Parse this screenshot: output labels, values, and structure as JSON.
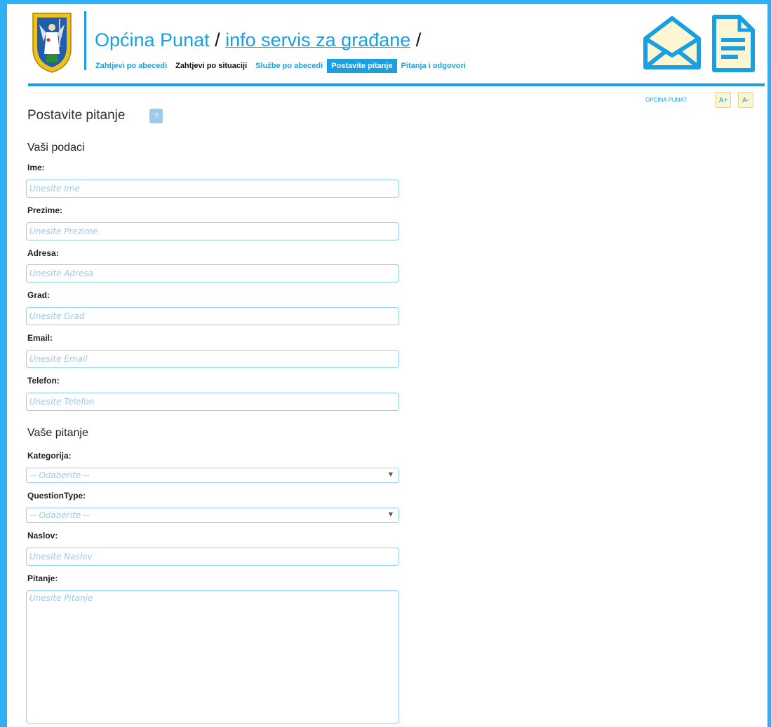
{
  "header": {
    "municipality": "Općina Punat",
    "separator1": " / ",
    "service": "info servis za građane",
    "separator2": " /",
    "nav": [
      {
        "label": "Zahtjevi po abecedi"
      },
      {
        "label": "Zahtjevi po situaciji"
      },
      {
        "label": "Službe po abecedi"
      },
      {
        "label": "Postavite pitanje",
        "active": true
      },
      {
        "label": "Pitanja i odgovori"
      }
    ],
    "icons": [
      "mail-icon",
      "document-icon"
    ]
  },
  "breadcrumb": "OPĆINA PUNAT",
  "font_controls": {
    "increase": "A+",
    "decrease": "A-"
  },
  "page_title": "Postavite pitanje",
  "help_label": "?",
  "sections": {
    "personal": "Vaši podaci",
    "question": "Vaše pitanje"
  },
  "form": {
    "ime": {
      "label": "Ime:",
      "placeholder": "Unesite Ime"
    },
    "prezime": {
      "label": "Prezime:",
      "placeholder": "Unesite Prezime"
    },
    "adresa": {
      "label": "Adresa:",
      "placeholder": "Unesite Adresa"
    },
    "grad": {
      "label": "Grad:",
      "placeholder": "Unesite Grad"
    },
    "email": {
      "label": "Email:",
      "placeholder": "Unesite Email"
    },
    "telefon": {
      "label": "Telefon:",
      "placeholder": "Unesite Telefon"
    },
    "kategorija": {
      "label": "Kategorija:",
      "selected": "-- Odaberite --"
    },
    "question_type": {
      "label": "QuestionType:",
      "selected": "-- Odaberite --"
    },
    "naslov": {
      "label": "Naslov:",
      "placeholder": "Unesite Naslov"
    },
    "pitanje": {
      "label": "Pitanje:",
      "placeholder": "Unesite Pitanje"
    }
  },
  "colors": {
    "accent": "#1a9fe0",
    "frame": "#2fb0f2",
    "field_border": "#8fd0f5",
    "placeholder": "#9ec9e8"
  }
}
